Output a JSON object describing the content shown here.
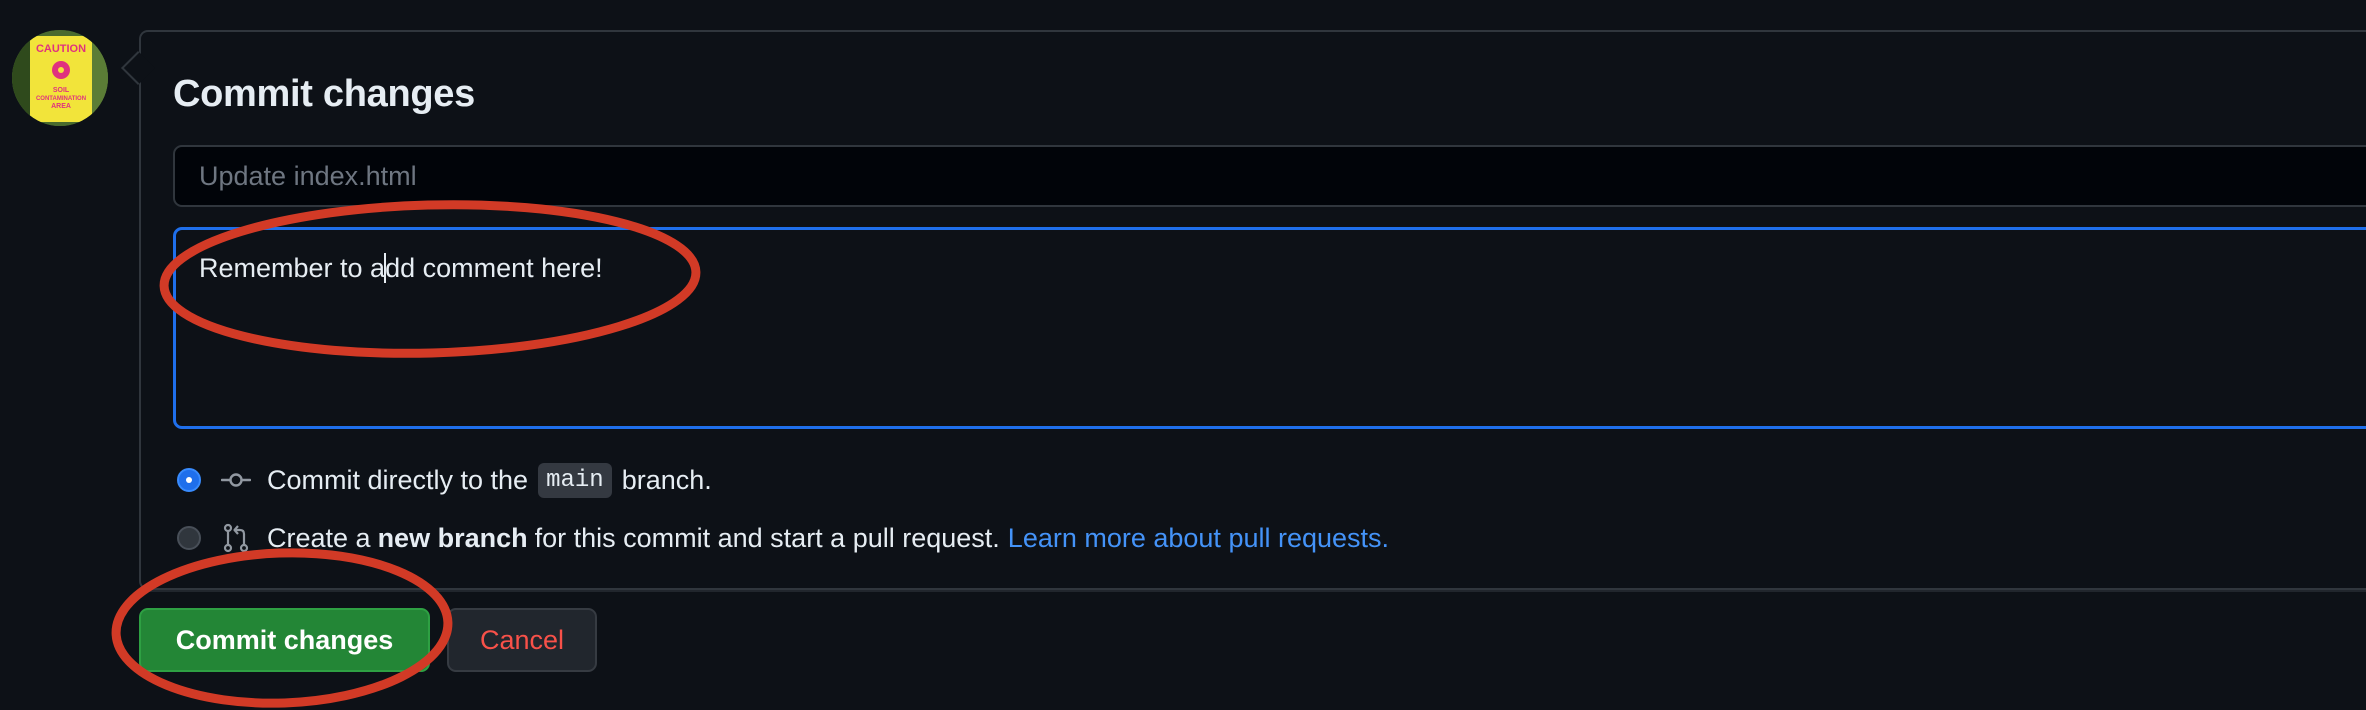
{
  "commit_panel": {
    "title": "Commit changes",
    "summary": {
      "value": "",
      "placeholder": "Update index.html"
    },
    "description": {
      "text_before_caret": "Remember to a",
      "text_after_caret": "dd comment here!"
    },
    "options": [
      {
        "checked": true,
        "icon": "git-commit-icon",
        "text_before": "Commit directly to the",
        "branch": "main",
        "text_after": "branch."
      },
      {
        "checked": false,
        "icon": "git-pull-request-icon",
        "text_before": "Create a",
        "bold": "new branch",
        "text_after": "for this commit and start a pull request.",
        "link": "Learn more about pull requests."
      }
    ],
    "buttons": {
      "commit_label": "Commit changes",
      "cancel_label": "Cancel"
    }
  },
  "colors": {
    "background": "#0d1117",
    "focus_border": "#1f6feb",
    "commit_button": "#238636",
    "cancel_text": "#f85149",
    "link": "#4493f8",
    "annotation": "#d23a26"
  },
  "avatar": {
    "description_icon": "caution-sign-avatar",
    "sign_text": [
      "CAUTION",
      "SOIL",
      "CONTAMINATION",
      "AREA"
    ]
  }
}
